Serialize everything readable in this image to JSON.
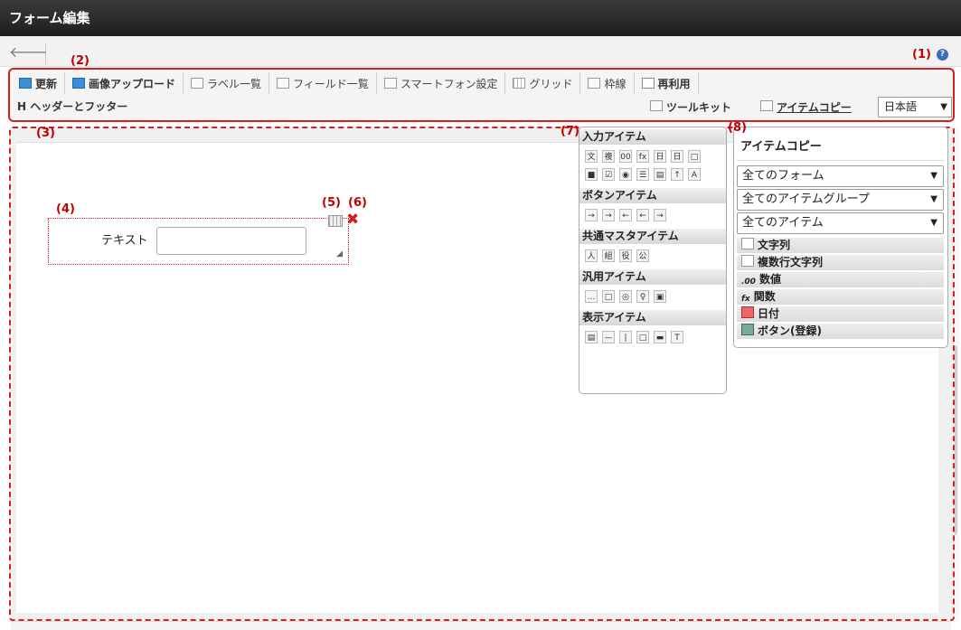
{
  "window": {
    "title": "フォーム編集"
  },
  "annotations": [
    "(1)",
    "(2)",
    "(3)",
    "(4)",
    "(5)",
    "(6)",
    "(7)",
    "(8)"
  ],
  "toolbar": {
    "row1": [
      {
        "label": "更新",
        "icon": "refresh-icon"
      },
      {
        "label": "画像アップロード",
        "icon": "image-upload-icon"
      },
      {
        "label": "ラベル一覧",
        "icon": "list-icon"
      },
      {
        "label": "フィールド一覧",
        "icon": "list-icon"
      },
      {
        "label": "スマートフォン設定",
        "icon": "list-icon"
      },
      {
        "label": "グリッド",
        "icon": "grid-icon"
      },
      {
        "label": "枠線",
        "icon": "border-icon"
      },
      {
        "label": "再利用",
        "icon": "reuse-icon"
      }
    ],
    "header_footer": "H ヘッダーとフッター",
    "toolkit": "ツールキット",
    "item_copy": "アイテムコピー",
    "language": "日本語"
  },
  "form_item": {
    "label": "テキスト",
    "value": ""
  },
  "palette": {
    "sections": [
      {
        "title": "入力アイテム",
        "icons": [
          "文",
          "複",
          "00",
          "fx",
          "日",
          "日",
          "□",
          "■",
          "☑",
          "◉",
          "☰",
          "▤",
          "↑",
          "A"
        ]
      },
      {
        "title": "ボタンアイテム",
        "icons": [
          "→",
          "→",
          "←",
          "←",
          "→"
        ]
      },
      {
        "title": "共通マスタアイテム",
        "icons": [
          "人",
          "組",
          "役",
          "公"
        ]
      },
      {
        "title": "汎用アイテム",
        "icons": [
          "…",
          "□",
          "◎",
          "♀",
          "▣"
        ]
      },
      {
        "title": "表示アイテム",
        "icons": [
          "▤",
          "—",
          "|",
          "□",
          "▬",
          "T"
        ]
      }
    ]
  },
  "item_copy_panel": {
    "title": "アイテムコピー",
    "selects": [
      "全てのフォーム",
      "全てのアイテムグループ",
      "全てのアイテム"
    ],
    "items": [
      {
        "label": "文字列",
        "icon": "□"
      },
      {
        "label": "複数行文字列",
        "icon": "□"
      },
      {
        "label": "数値",
        "icon": ".00"
      },
      {
        "label": "関数",
        "icon": "fx"
      },
      {
        "label": "日付",
        "icon": "cal"
      },
      {
        "label": "ボタン(登録)",
        "icon": "btn"
      }
    ]
  }
}
